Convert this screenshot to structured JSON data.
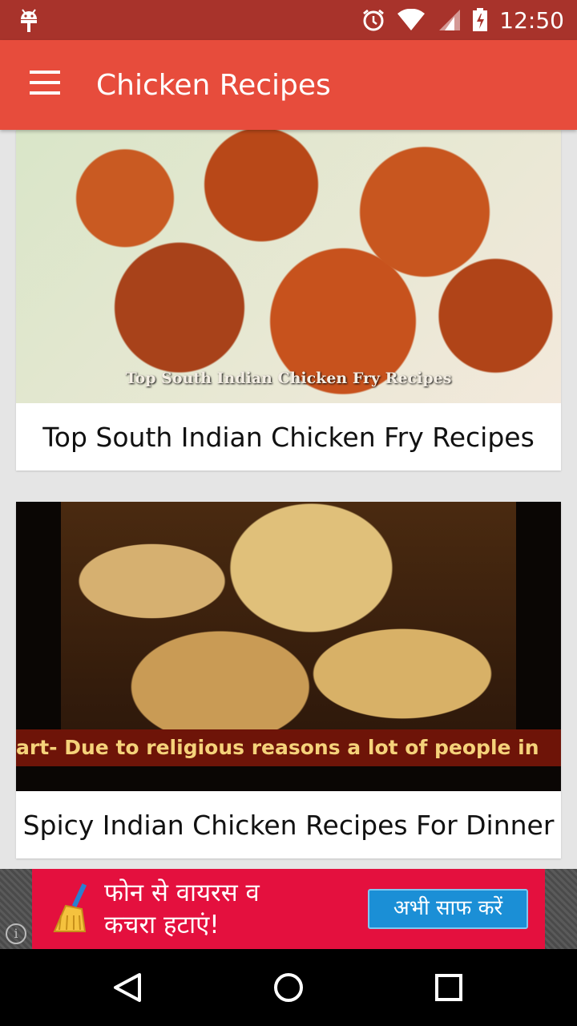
{
  "status_bar": {
    "time": "12:50",
    "icons": [
      "android-debug-icon",
      "alarm-icon",
      "wifi-icon",
      "signal-icon",
      "battery-icon"
    ]
  },
  "app_bar": {
    "title": "Chicken Recipes",
    "menu_icon": "hamburger-menu-icon",
    "background": "#e74c3c"
  },
  "cards": [
    {
      "thumbnail_text": "Top South Indian Chicken Fry Recipes",
      "caption": "Top South Indian Chicken Fry Recipes"
    },
    {
      "thumbnail_text": "art- Due to religious reasons a lot of people in",
      "caption": "Spicy Indian Chicken Recipes For Dinner"
    }
  ],
  "ad": {
    "text_line1": "फोन से वायरस व",
    "text_line2": "कचरा हटाएं!",
    "button_label": "अभी साफ करें",
    "info_icon": "i",
    "background": "#e4103e"
  },
  "nav_bar": {
    "icons": [
      "back-icon",
      "home-icon",
      "recents-icon"
    ]
  }
}
